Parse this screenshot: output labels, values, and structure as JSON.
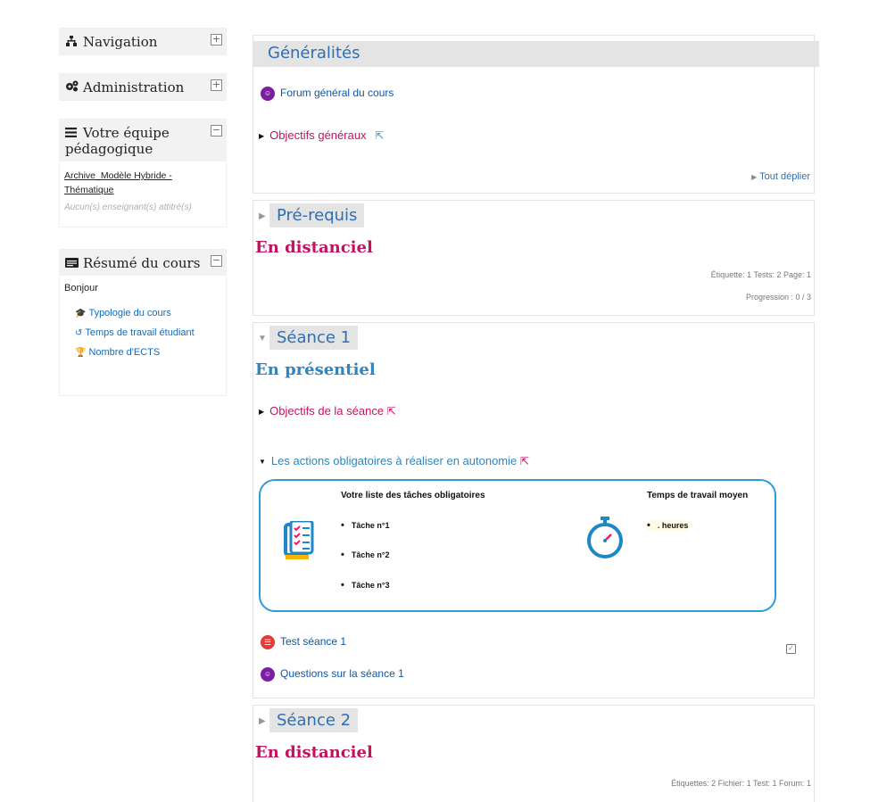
{
  "sidebar": {
    "navigation": {
      "title": "Navigation",
      "icon": "sitemap-icon",
      "toggle": "+"
    },
    "administration": {
      "title": "Administration",
      "icon": "cogs-icon",
      "toggle": "+"
    },
    "team": {
      "title": "Votre équipe pédagogique",
      "icon": "bars-icon",
      "toggle": "−",
      "link": "Archive_Modèle Hybride - Thématique",
      "note": "Aucun(s) enseignant(s) attitré(s)"
    },
    "summary": {
      "title": "Résumé du cours",
      "icon": "card-icon",
      "toggle": "−",
      "greeting": "Bonjour",
      "links": [
        {
          "label": "Typologie du cours",
          "icon": "graduation-cap-icon",
          "glyph": "🎓"
        },
        {
          "label": "Temps de travail étudiant",
          "icon": "history-icon",
          "glyph": "↺"
        },
        {
          "label": "Nombre d'ECTS",
          "icon": "trophy-icon",
          "glyph": "🏆"
        }
      ]
    }
  },
  "sections": {
    "general": {
      "title": "Généralités",
      "forum": "Forum général du cours",
      "objectives": "Objectifs généraux",
      "expand_all": "Tout déplier"
    },
    "prereq": {
      "title": "Pré-requis",
      "subtitle": "En distanciel",
      "summary": "Étiquette: 1  Tests: 2  Page: 1",
      "progress": "Progression : 0 / 3"
    },
    "seance1": {
      "title": "Séance 1",
      "subtitle": "En présentiel",
      "objectives": "Objectifs de la séance",
      "actions": "Les actions obligatoires à réaliser en autonomie",
      "tasks_heading": "Votre liste des tâches obligatoires",
      "tasks": [
        "Tâche n°1",
        "Tâche n°2",
        "Tâche n°3"
      ],
      "time_heading": "Temps de travail moyen",
      "time_value": ". heures",
      "quiz": "Test séance 1",
      "forum": "Questions sur la séance 1"
    },
    "seance2": {
      "title": "Séance 2",
      "subtitle": "En distanciel",
      "summary": "Étiquettes: 2  Fichier: 1  Test: 1  Forum: 1"
    }
  },
  "colors": {
    "accent_blue": "#2f6fb3",
    "magenta": "#c3125f",
    "box_border": "#2e9bd6"
  }
}
